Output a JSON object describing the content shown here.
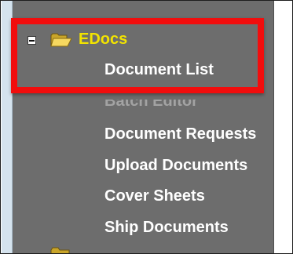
{
  "tree": {
    "root": {
      "label": "EDocs",
      "icon": "folder-open-icon",
      "label_color": "#f2e300"
    },
    "children": [
      {
        "label": "Document List",
        "name": "tree-item-document-list"
      },
      {
        "label": "Batch Editor",
        "name": "tree-item-batch-editor"
      },
      {
        "label": "Document Requests",
        "name": "tree-item-document-requests"
      },
      {
        "label": "Upload Documents",
        "name": "tree-item-upload-documents"
      },
      {
        "label": "Cover Sheets",
        "name": "tree-item-cover-sheets"
      },
      {
        "label": "Ship Documents",
        "name": "tree-item-ship-documents"
      }
    ]
  },
  "colors": {
    "panel": "#6d6d6d",
    "highlight": "#f10d0d",
    "text": "#ffffff"
  }
}
